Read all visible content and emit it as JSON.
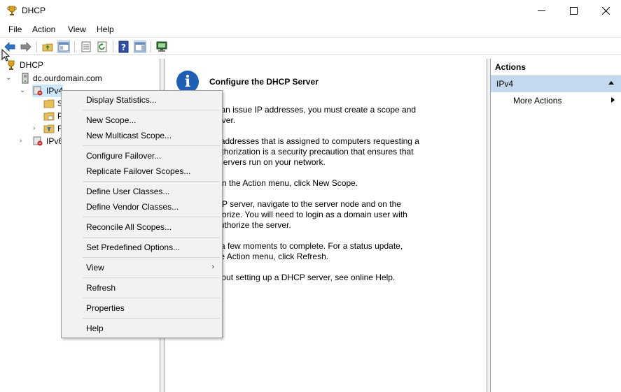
{
  "window": {
    "title": "DHCP",
    "icon": "dhcp-trophy-icon"
  },
  "menu": {
    "items": [
      "File",
      "Action",
      "View",
      "Help"
    ]
  },
  "toolbar": {
    "buttons": [
      "back-icon",
      "forward-icon",
      "up-folder-icon",
      "show-hide-console-tree-icon",
      "properties-icon",
      "refresh-icon",
      "help-icon",
      "show-action-pane-icon",
      "monitor-icon"
    ]
  },
  "tree": {
    "root": "DHCP",
    "server": "dc.ourdomain.com",
    "ipv4": "IPv4",
    "ipv6": "IPv6",
    "child1": "S",
    "child2": "P",
    "child3": "F"
  },
  "center": {
    "title": "Configure the DHCP Server",
    "paragraphs": [
      "CP server can issue IP addresses, you must create a scope and\ne DHCP server.",
      "range of IP addresses that is assigned to computers requesting a\naddress. Authorization is a security precaution that ensures that\nzed DHCP servers run on your network.",
      "ew scope, on the Action menu, click New Scope.",
      "ze this DHCP server, navigate to the server node and on the\nu, click Authorize. You will need to login as a domain user with\nvileges to authorize the server.",
      "n may take a few moments to complete. For a status update,\nF5, or on the Action menu, click Refresh.",
      "ormation about setting up a DHCP server, see online Help."
    ]
  },
  "actions": {
    "header": "Actions",
    "section": "IPv4",
    "more": "More Actions"
  },
  "context_menu": {
    "items": [
      "Display Statistics...",
      "New Scope...",
      "New Multicast Scope...",
      "Configure Failover...",
      "Replicate Failover Scopes...",
      "Define User Classes...",
      "Define Vendor Classes...",
      "Reconcile All Scopes...",
      "Set Predefined Options...",
      "View",
      "Refresh",
      "Properties",
      "Help"
    ]
  }
}
